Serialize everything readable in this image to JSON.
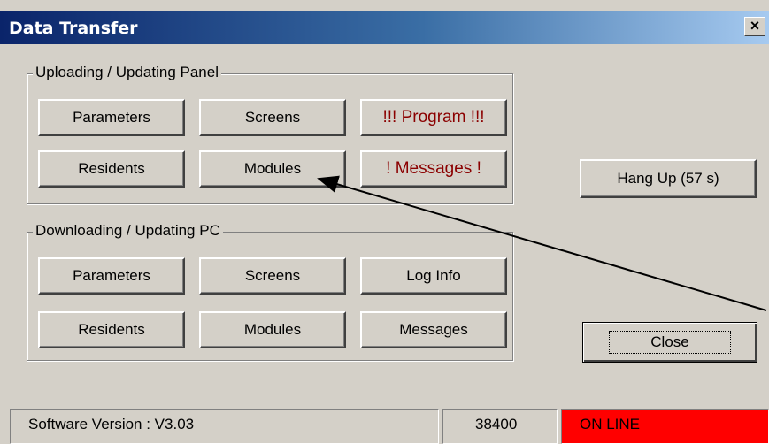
{
  "window": {
    "title": "Data Transfer",
    "close_glyph": "×"
  },
  "upload_group": {
    "label": "Uploading / Updating Panel",
    "buttons": [
      "Parameters",
      "Screens",
      "!!! Program !!!",
      "Residents",
      "Modules",
      "! Messages !"
    ]
  },
  "download_group": {
    "label": "Downloading / Updating PC",
    "buttons": [
      "Parameters",
      "Screens",
      "Log Info",
      "Residents",
      "Modules",
      "Messages"
    ]
  },
  "hangup_label": "Hang Up (57 s)",
  "close_label": "Close",
  "status": {
    "version": "Software Version : V3.03",
    "baud": "38400",
    "connection": "ON LINE"
  },
  "colors": {
    "online_bg": "#ff0000",
    "warning_text": "#8b0000",
    "title_start": "#0a246a",
    "title_end": "#a6caf0"
  }
}
